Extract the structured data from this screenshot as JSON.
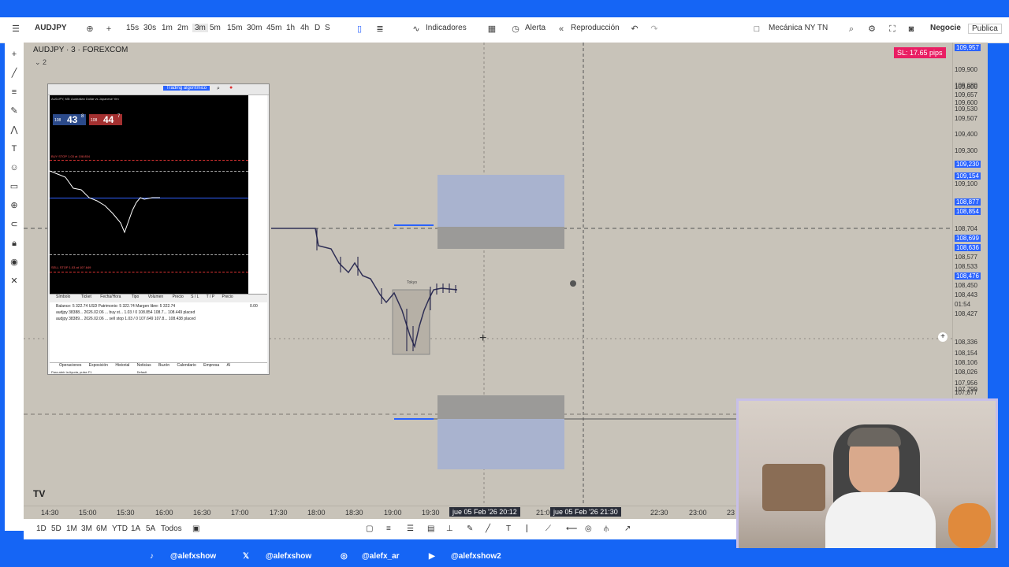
{
  "toolbar": {
    "symbol": "AUDJPY",
    "intervals": [
      "15s",
      "30s",
      "1m",
      "2m",
      "3m",
      "5m",
      "15m",
      "30m",
      "45m",
      "1h",
      "4h",
      "D",
      "S"
    ],
    "active_interval": "3m",
    "indicators_label": "Indicadores",
    "alert_label": "Alerta",
    "replay_label": "Reproducción",
    "layout_name": "Mecánica NY TN",
    "trade_label": "Negocie",
    "publish_label": "Publica"
  },
  "chart": {
    "title": "AUDJPY · 3 · FOREXCOM",
    "indicator_count": "2",
    "sl_badge": "SL: 17.65 pips",
    "session_label": "Tokyo",
    "price_labels": [
      {
        "v": "109,957",
        "hl": true
      },
      {
        "v": "109,900",
        "hl": false
      },
      {
        "v": "109,800",
        "hl": false
      },
      {
        "v": "109,680",
        "hl": false
      },
      {
        "v": "109,657",
        "hl": false
      },
      {
        "v": "109,600",
        "hl": false
      },
      {
        "v": "109,530",
        "hl": false
      },
      {
        "v": "109,507",
        "hl": false
      },
      {
        "v": "109,400",
        "hl": false
      },
      {
        "v": "109,300",
        "hl": false
      },
      {
        "v": "109,230",
        "hl": true
      },
      {
        "v": "109,154",
        "hl": true
      },
      {
        "v": "109,100",
        "hl": false
      },
      {
        "v": "108,877",
        "hl": true
      },
      {
        "v": "108,854",
        "hl": true
      },
      {
        "v": "108,704",
        "hl": false
      },
      {
        "v": "108,699",
        "hl": true
      },
      {
        "v": "108,636",
        "hl": true
      },
      {
        "v": "108,577",
        "hl": false
      },
      {
        "v": "108,533",
        "hl": false
      },
      {
        "v": "108,476",
        "hl": true
      },
      {
        "v": "108,450",
        "hl": false
      },
      {
        "v": "108,443",
        "hl": false
      },
      {
        "v": "01:54",
        "hl": false
      },
      {
        "v": "108,427",
        "hl": false
      },
      {
        "v": "108,336",
        "hl": false
      },
      {
        "v": "108,154",
        "hl": false
      },
      {
        "v": "108,106",
        "hl": false
      },
      {
        "v": "108,026",
        "hl": false
      },
      {
        "v": "107,956",
        "hl": false
      },
      {
        "v": "107,877",
        "hl": false
      },
      {
        "v": "107,799",
        "hl": false
      }
    ],
    "time_labels": [
      "14:30",
      "15:00",
      "15:30",
      "16:00",
      "16:30",
      "17:00",
      "17:30",
      "18:00",
      "18:30",
      "19:00",
      "19:30",
      "21:00",
      "22:30",
      "23:00",
      "23"
    ],
    "crosshair_time_1": "jue 05 Feb '26  20:12",
    "crosshair_time_2": "jue 05 Feb '26  21:30"
  },
  "terminal": {
    "symbol_line": "AUDJPY, M5: Australian Dollar vs Japanese Yen",
    "sell_price": "43",
    "sell_sup": "8",
    "buy_price": "44",
    "buy_sup": "7",
    "sell_prefix": "108",
    "buy_prefix": "108",
    "algo_label": "Trading algorítmico",
    "buy_stop_label": "BUY STOP 1.03 at 108.854",
    "sell_stop_label": "SELL STOP 1.03 at 107.649",
    "table_headers": [
      "Símbolo",
      "Ticket",
      "Fecha/Hora",
      "Tipo",
      "Volumen",
      "Precio",
      "S / L",
      "T / P",
      "Precio"
    ],
    "balance_line": "Balance: 5 322.74 USD  Patrimonio: 5 322.74  Margen libre: 5 322.74",
    "balance_value": "0.00",
    "rows": [
      "audjpy  38388...  2026.02.06 ...  buy st...  1.03 / 0  108.854  108.7...  108.449  placed",
      "audjpy  38389...  2026.02.06 ...  sell stop  1.03 / 0  107.649  107.8...  108.438  placed"
    ],
    "tabs": [
      "Operaciones",
      "Exposición",
      "Historial",
      "Noticias",
      "Buzón",
      "Calendario",
      "Empresa",
      "Al"
    ],
    "status_left": "Para abrir la Ayuda, pulse F1",
    "status_right": "Default"
  },
  "bottom": {
    "ranges": [
      "1D",
      "5D",
      "1M",
      "3M",
      "6M",
      "YTD",
      "1A",
      "5A",
      "Todos"
    ]
  },
  "social": [
    {
      "icon": "tiktok-icon",
      "handle": "@alefxshow"
    },
    {
      "icon": "x-icon",
      "handle": "@alefxshow"
    },
    {
      "icon": "instagram-icon",
      "handle": "@alefx_ar"
    },
    {
      "icon": "youtube-icon",
      "handle": "@alefxshow2"
    }
  ],
  "colors": {
    "accent": "#2962ff",
    "brand_blue": "#1565f5",
    "chart_bg": "#c8c3b9",
    "zone_blue": "#a9b3cf",
    "zone_gray": "#9b9a98",
    "sl_badge": "#e91e63"
  }
}
